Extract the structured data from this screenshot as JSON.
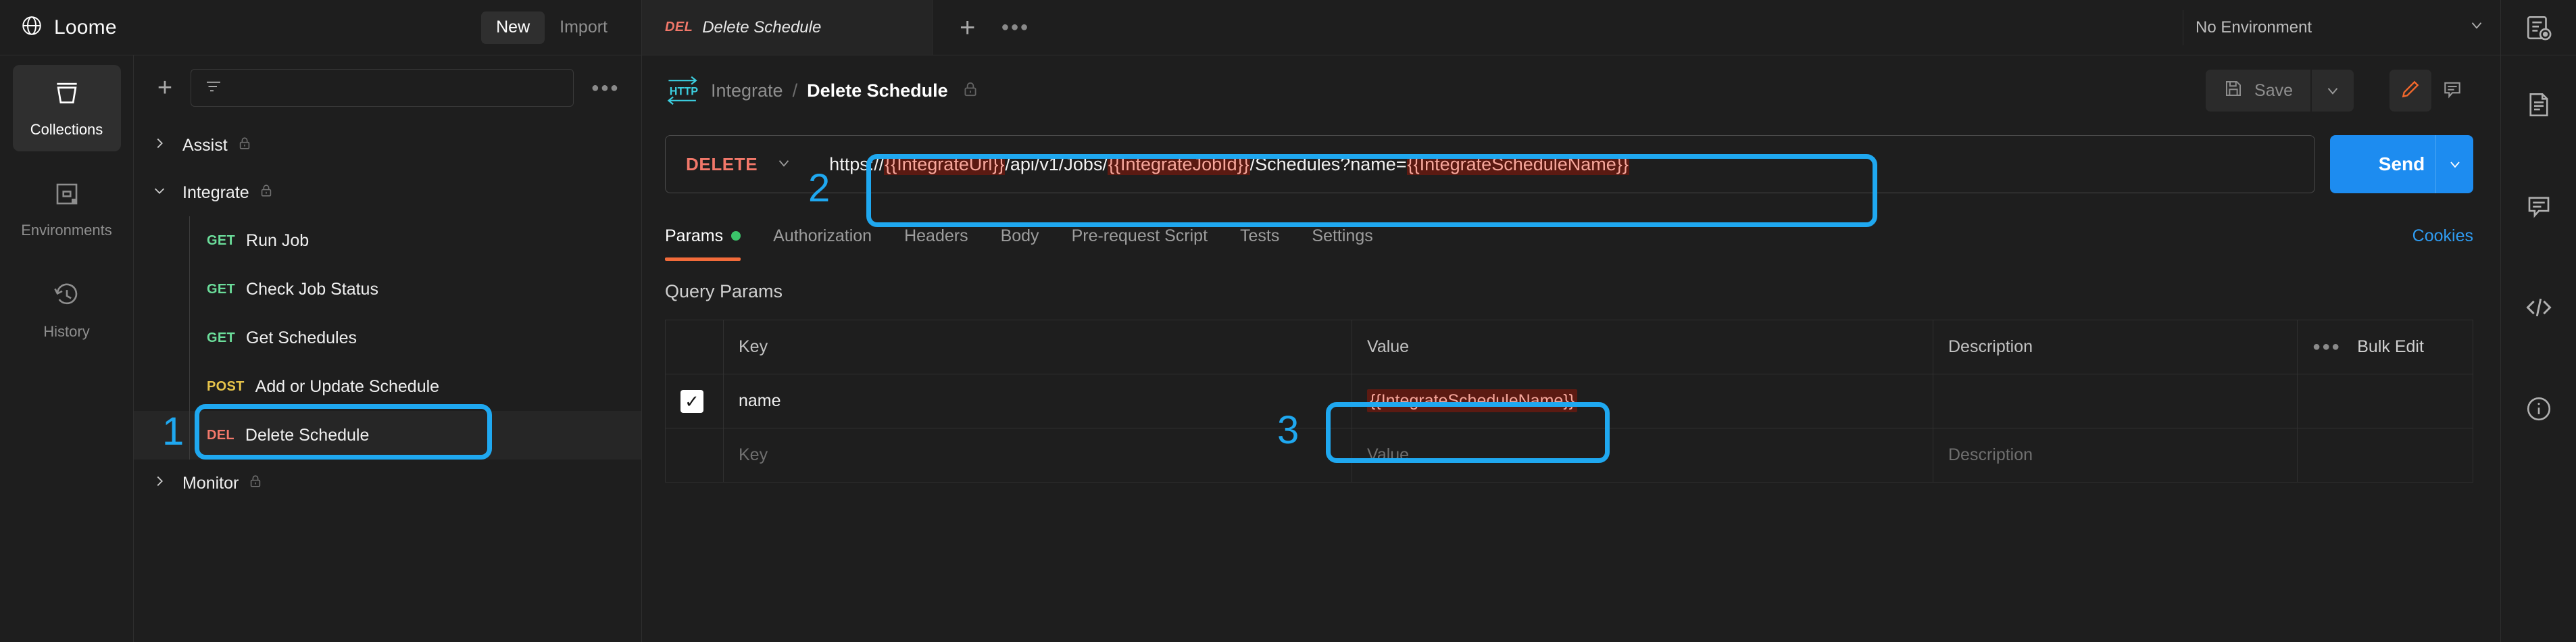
{
  "app": {
    "brand_name": "Loome",
    "brand_icon": "globe-icon"
  },
  "topbar": {
    "new_label": "New",
    "import_label": "Import",
    "tab": {
      "method": "DEL",
      "title": "Delete Schedule"
    },
    "new_tab_icon": "plus-icon",
    "tab_options_icon": "more-horizontal-icon",
    "environment_selected": "No Environment",
    "environment_caret": "chevron-down-icon",
    "env_quicklook_icon": "environment-quick-look-icon"
  },
  "rail": {
    "items": [
      {
        "label": "Collections",
        "icon": "collections-icon",
        "active": true
      },
      {
        "label": "Environments",
        "icon": "environments-icon",
        "active": false
      },
      {
        "label": "History",
        "icon": "history-icon",
        "active": false
      }
    ]
  },
  "sidebar": {
    "add_icon": "plus-icon",
    "filter_icon": "filter-icon",
    "search_placeholder": "",
    "more_icon": "more-horizontal-icon",
    "tree": [
      {
        "name": "Assist",
        "expanded": false,
        "locked": true,
        "children": []
      },
      {
        "name": "Integrate",
        "expanded": true,
        "locked": true,
        "children": [
          {
            "method": "GET",
            "label": "Run Job",
            "selected": false
          },
          {
            "method": "GET",
            "label": "Check Job Status",
            "selected": false
          },
          {
            "method": "GET",
            "label": "Get Schedules",
            "selected": false
          },
          {
            "method": "POST",
            "label": "Add or Update Schedule",
            "selected": false
          },
          {
            "method": "DEL",
            "label": "Delete Schedule",
            "selected": true
          }
        ]
      },
      {
        "name": "Monitor",
        "expanded": false,
        "locked": true,
        "children": []
      }
    ]
  },
  "request": {
    "protocol_badge": "HTTP",
    "breadcrumb_collection": "Integrate",
    "breadcrumb_separator": "/",
    "breadcrumb_current": "Delete Schedule",
    "breadcrumb_lock_icon": "lock-icon",
    "save_label": "Save",
    "save_icon": "floppy-disk-icon",
    "save_caret_icon": "chevron-down-icon",
    "edit_icon": "pencil-icon",
    "comment_icon": "comment-icon",
    "method": "DELETE",
    "method_caret_icon": "chevron-down-icon",
    "url_segments": [
      {
        "text": "https://",
        "variable": false
      },
      {
        "text": "{{IntegrateUrl}}",
        "variable": true
      },
      {
        "text": "/api/v1/Jobs/",
        "variable": false
      },
      {
        "text": "{{IntegrateJobId}}",
        "variable": true
      },
      {
        "text": "/Schedules?name=",
        "variable": false
      },
      {
        "text": "{{IntegrateScheduleName}}",
        "variable": true
      }
    ],
    "url_full": "https://{{IntegrateUrl}}/api/v1/Jobs/{{IntegrateJobId}}/Schedules?name={{IntegrateScheduleName}}",
    "send_label": "Send",
    "send_caret_icon": "chevron-down-icon",
    "tabs": [
      {
        "label": "Params",
        "active": true,
        "has_dot": true
      },
      {
        "label": "Authorization",
        "active": false,
        "has_dot": false
      },
      {
        "label": "Headers",
        "active": false,
        "has_dot": false
      },
      {
        "label": "Body",
        "active": false,
        "has_dot": false
      },
      {
        "label": "Pre-request Script",
        "active": false,
        "has_dot": false
      },
      {
        "label": "Tests",
        "active": false,
        "has_dot": false
      },
      {
        "label": "Settings",
        "active": false,
        "has_dot": false
      }
    ],
    "cookies_label": "Cookies",
    "section_title": "Query Params",
    "table": {
      "headers": [
        "",
        "Key",
        "Value",
        "Description"
      ],
      "bulk_edit_label": "Bulk Edit",
      "bulk_more_icon": "more-horizontal-icon",
      "rows": [
        {
          "checked": true,
          "check_glyph": "✓",
          "key": "name",
          "value": "{{IntegrateScheduleName}}",
          "value_is_variable": true,
          "description": ""
        }
      ],
      "empty_row": {
        "key_placeholder": "Key",
        "value_placeholder": "Value",
        "description_placeholder": "Description"
      }
    }
  },
  "right_rail": {
    "items": [
      {
        "icon": "environment-quick-look-icon"
      },
      {
        "icon": "documentation-icon"
      },
      {
        "icon": "comment-icon"
      },
      {
        "icon": "code-snippet-icon"
      },
      {
        "icon": "info-icon"
      }
    ]
  },
  "annotations": {
    "accent_color": "#1FA8F0",
    "markers": [
      {
        "number": "1",
        "target": "sidebar-item-delete-schedule"
      },
      {
        "number": "2",
        "target": "url-input"
      },
      {
        "number": "3",
        "target": "param-value-cell"
      }
    ]
  },
  "colors": {
    "accent_blue": "#1D8CF0",
    "annotation_blue": "#1FA8F0",
    "method_delete": "#F2786A",
    "method_get": "#6BDD9A",
    "method_post": "#E6C34A",
    "variable_bg": "#5B1A12",
    "variable_fg": "#F7A79C",
    "tab_underline": "#F26B3A",
    "background": "#1E1E1E"
  }
}
